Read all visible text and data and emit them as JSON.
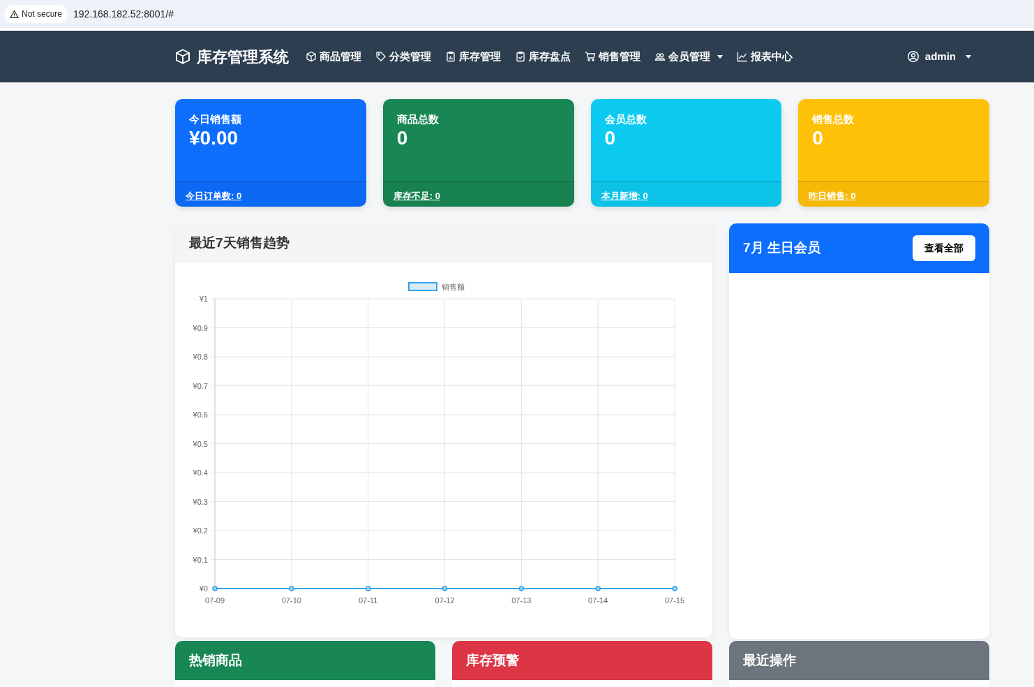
{
  "browser": {
    "security": "Not secure",
    "url": "192.168.182.52:8001/#"
  },
  "navbar": {
    "brand": "库存管理系统",
    "items": [
      {
        "label": "商品管理",
        "dropdown": false
      },
      {
        "label": "分类管理",
        "dropdown": false
      },
      {
        "label": "库存管理",
        "dropdown": false
      },
      {
        "label": "库存盘点",
        "dropdown": false
      },
      {
        "label": "销售管理",
        "dropdown": false
      },
      {
        "label": "会员管理",
        "dropdown": true
      },
      {
        "label": "报表中心",
        "dropdown": false
      }
    ],
    "user": {
      "label": "admin",
      "dropdown": true
    }
  },
  "stats": [
    {
      "title": "今日销售额",
      "value": "¥0.00",
      "link": "今日订单数: 0",
      "color": "#0d6efd"
    },
    {
      "title": "商品总数",
      "value": "0",
      "link": "库存不足: 0",
      "color": "#198754"
    },
    {
      "title": "会员总数",
      "value": "0",
      "link": "本月新增: 0",
      "color": "#0dcaf0"
    },
    {
      "title": "销售总数",
      "value": "0",
      "link": "昨日销售: 0",
      "color": "#ffc107"
    }
  ],
  "sales_chart": {
    "title": "最近7天销售趋势",
    "chart_data": {
      "type": "line",
      "categories": [
        "07-09",
        "07-10",
        "07-11",
        "07-12",
        "07-13",
        "07-14",
        "07-15"
      ],
      "series": [
        {
          "name": "销售额",
          "color": "#36a2eb",
          "marker": true,
          "values": [
            0,
            0,
            0,
            0,
            0,
            0,
            0
          ]
        }
      ],
      "ylim": [
        0,
        1
      ],
      "grid": true,
      "yticks": [
        {
          "value": 0,
          "label": "¥0"
        },
        {
          "value": 0.1,
          "label": "¥0.1"
        },
        {
          "value": 0.2,
          "label": "¥0.2"
        },
        {
          "value": 0.3,
          "label": "¥0.3"
        },
        {
          "value": 0.4,
          "label": "¥0.4"
        },
        {
          "value": 0.5,
          "label": "¥0.5"
        },
        {
          "value": 0.6,
          "label": "¥0.6"
        },
        {
          "value": 0.7,
          "label": "¥0.7"
        },
        {
          "value": 0.8,
          "label": "¥0.8"
        },
        {
          "value": 0.9,
          "label": "¥0.9"
        },
        {
          "value": 1,
          "label": "¥1"
        }
      ]
    }
  },
  "birthday": {
    "title": "7月 生日会员",
    "button": "查看全部"
  },
  "panels": [
    {
      "title": "热销商品",
      "color": "#198754"
    },
    {
      "title": "库存预警",
      "color": "#dc3545"
    },
    {
      "title": "最近操作",
      "color": "#6c757d"
    }
  ]
}
